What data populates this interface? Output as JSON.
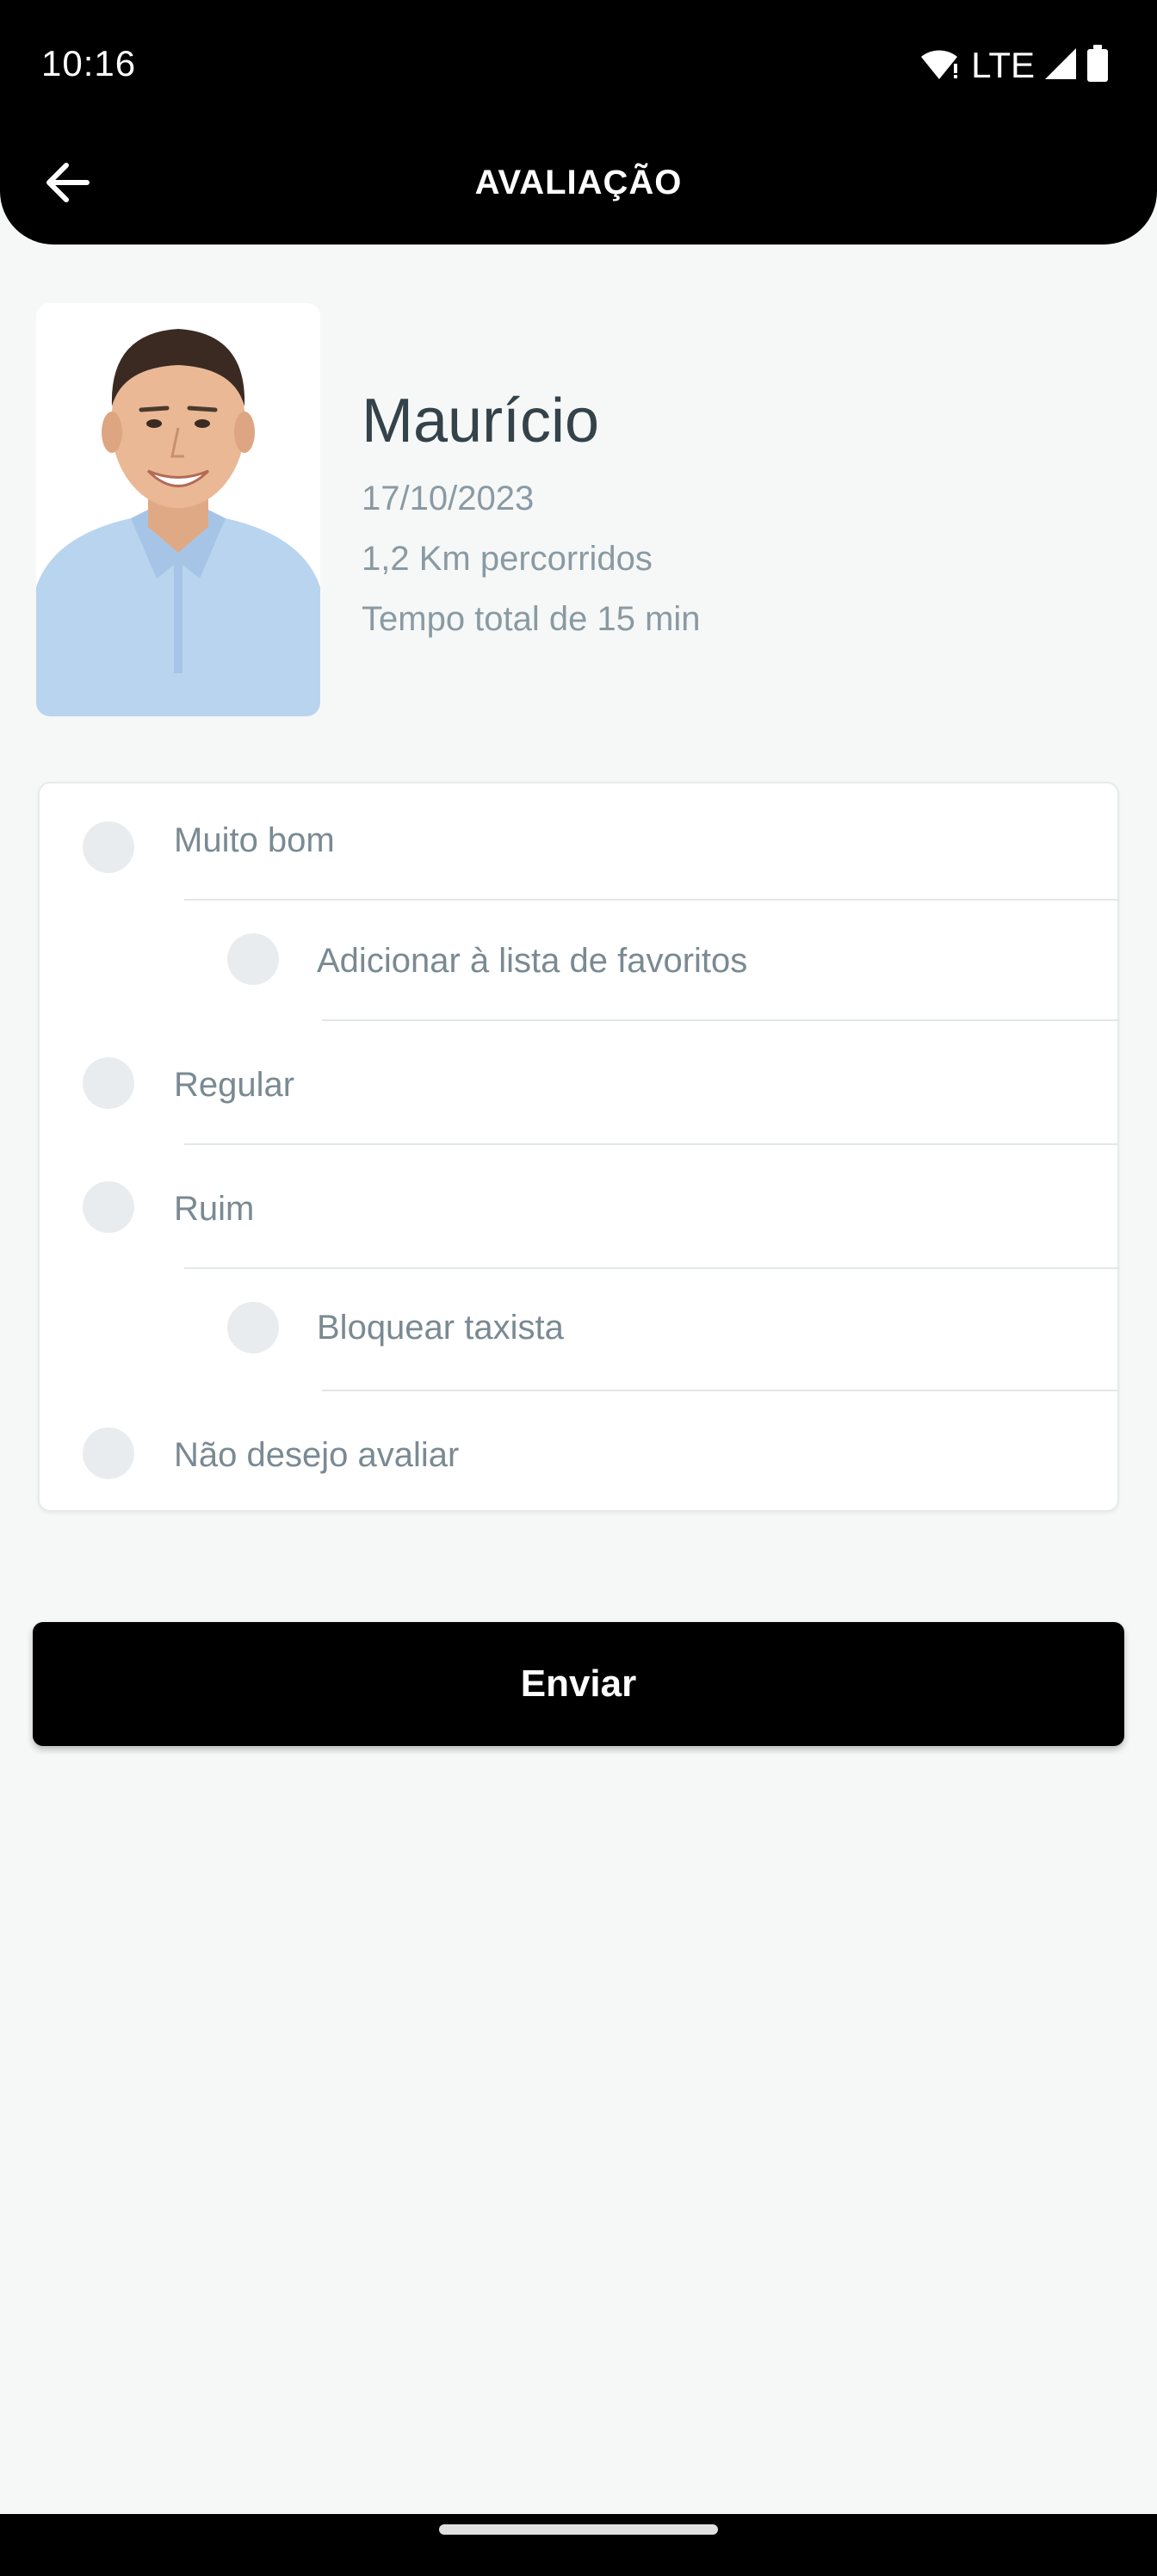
{
  "status_bar": {
    "time": "10:16",
    "network": "LTE",
    "icons": [
      "wifi-icon",
      "signal-icon",
      "battery-icon"
    ]
  },
  "header": {
    "title": "AVALIAÇÃO",
    "back_icon": "arrow-left-icon"
  },
  "driver": {
    "name": "Maurício",
    "date": "17/10/2023",
    "distance": "1,2 Km percorridos",
    "duration": "Tempo total de 15 min"
  },
  "rating_options": [
    {
      "label": "Muito bom",
      "selected": false
    },
    {
      "label": "Adicionar à lista de favoritos",
      "selected": false,
      "sub_option": true
    },
    {
      "label": "Regular",
      "selected": false
    },
    {
      "label": "Ruim",
      "selected": false
    },
    {
      "label": "Bloquear taxista",
      "selected": false,
      "sub_option": true
    },
    {
      "label": "Não desejo avaliar",
      "selected": false
    }
  ],
  "submit": {
    "label": "Enviar"
  },
  "colors": {
    "accent": "#000000",
    "background": "#f6f8f8",
    "text_secondary": "#8a9aa3"
  }
}
